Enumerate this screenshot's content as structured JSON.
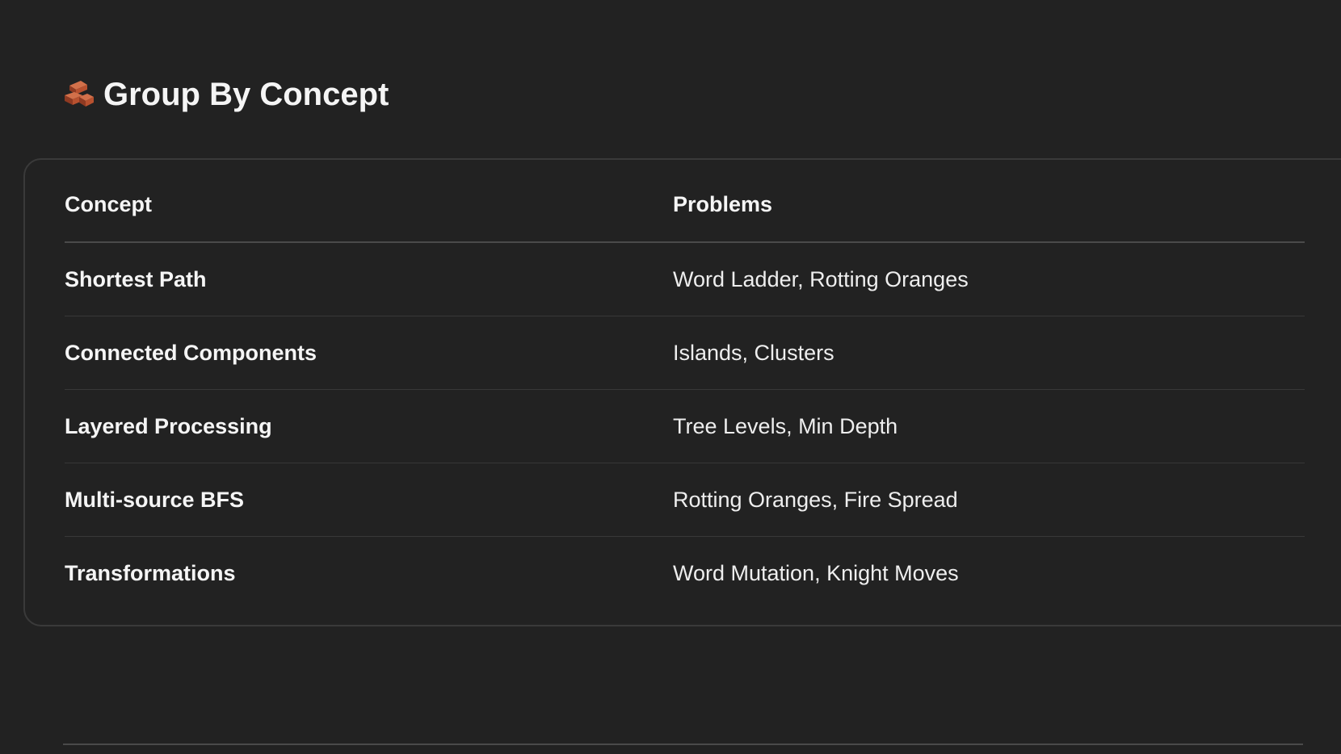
{
  "heading": {
    "icon": "bricks-icon",
    "title": "Group By Concept"
  },
  "table": {
    "headers": {
      "concept": "Concept",
      "problems": "Problems"
    },
    "rows": [
      {
        "concept": "Shortest Path",
        "problems": "Word Ladder, Rotting Oranges"
      },
      {
        "concept": "Connected Components",
        "problems": "Islands, Clusters"
      },
      {
        "concept": "Layered Processing",
        "problems": "Tree Levels, Min Depth"
      },
      {
        "concept": "Multi-source BFS",
        "problems": "Rotting Oranges, Fire Spread"
      },
      {
        "concept": "Transformations",
        "problems": "Word Mutation, Knight Moves"
      }
    ]
  },
  "colors": {
    "background": "#222222",
    "text": "#f2f2f2",
    "border": "#3a3a3a",
    "brick": "#b8512f"
  }
}
